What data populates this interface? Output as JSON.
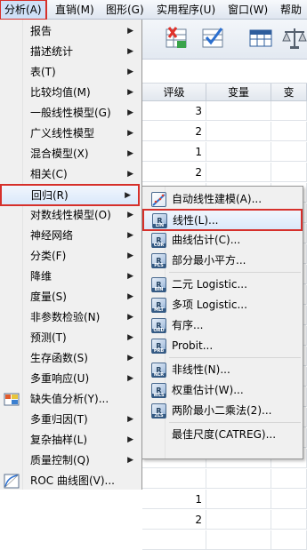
{
  "menubar": {
    "items": [
      {
        "label": "分析(A)"
      },
      {
        "label": "直销(M)"
      },
      {
        "label": "图形(G)"
      },
      {
        "label": "实用程序(U)"
      },
      {
        "label": "窗口(W)"
      },
      {
        "label": "帮助"
      }
    ]
  },
  "grid": {
    "headers": [
      "评级",
      "变量",
      "变"
    ],
    "values": [
      "3",
      "2",
      "1",
      "2",
      "",
      "",
      "",
      "",
      "",
      "",
      "",
      "",
      "",
      "",
      "",
      "",
      "",
      "",
      "",
      "1",
      "2",
      ""
    ]
  },
  "analyze_menu": {
    "items": [
      {
        "label": "报告",
        "submenu": true
      },
      {
        "label": "描述统计",
        "submenu": true
      },
      {
        "label": "表(T)",
        "submenu": true
      },
      {
        "label": "比较均值(M)",
        "submenu": true
      },
      {
        "label": "一般线性模型(G)",
        "submenu": true
      },
      {
        "label": "广义线性模型",
        "submenu": true
      },
      {
        "label": "混合模型(X)",
        "submenu": true
      },
      {
        "label": "相关(C)",
        "submenu": true
      },
      {
        "label": "回归(R)",
        "submenu": true,
        "highlighted": true
      },
      {
        "label": "对数线性模型(O)",
        "submenu": true
      },
      {
        "label": "神经网络",
        "submenu": true
      },
      {
        "label": "分类(F)",
        "submenu": true
      },
      {
        "label": "降维",
        "submenu": true
      },
      {
        "label": "度量(S)",
        "submenu": true
      },
      {
        "label": "非参数检验(N)",
        "submenu": true
      },
      {
        "label": "预测(T)",
        "submenu": true
      },
      {
        "label": "生存函数(S)",
        "submenu": true
      },
      {
        "label": "多重响应(U)",
        "submenu": true
      },
      {
        "label": "缺失值分析(Y)...",
        "submenu": false,
        "icon": "missing-value-icon"
      },
      {
        "label": "多重归因(T)",
        "submenu": true
      },
      {
        "label": "复杂抽样(L)",
        "submenu": true
      },
      {
        "label": "质量控制(Q)",
        "submenu": true
      },
      {
        "label": "ROC 曲线图(V)...",
        "submenu": false,
        "icon": "roc-curve-icon"
      }
    ]
  },
  "regression_submenu": {
    "items": [
      {
        "label": "自动线性建模(A)...",
        "icon": "auto-linear-modeling-icon",
        "badge": ""
      },
      {
        "label": "线性(L)...",
        "icon": "linear-regression-icon",
        "badge": "LIN",
        "highlighted": true
      },
      {
        "label": "曲线估计(C)...",
        "icon": "curve-estimation-icon",
        "badge": "CUR"
      },
      {
        "label": "部分最小平方...",
        "icon": "partial-least-squares-icon",
        "badge": "PLS"
      },
      {
        "label": "二元 Logistic...",
        "icon": "binary-logistic-icon",
        "badge": "BIN"
      },
      {
        "label": "多项 Logistic...",
        "icon": "multinomial-logistic-icon",
        "badge": "MLT"
      },
      {
        "label": "有序...",
        "icon": "ordinal-icon",
        "badge": "ORD"
      },
      {
        "label": "Probit...",
        "icon": "probit-icon",
        "badge": "PRB"
      },
      {
        "label": "非线性(N)...",
        "icon": "nonlinear-icon",
        "badge": "NLR"
      },
      {
        "label": "权重估计(W)...",
        "icon": "weight-estimation-icon",
        "badge": "WLS"
      },
      {
        "label": "两阶最小二乘法(2)...",
        "icon": "two-stage-least-squares-icon",
        "badge": "2LS"
      },
      {
        "label": "最佳尺度(CATREG)...",
        "icon": "",
        "badge": ""
      }
    ]
  },
  "colors": {
    "highlight_outline": "#d6302b",
    "menu_bg": "#f0f0f0",
    "highlight_bg": "#dae8fa"
  }
}
